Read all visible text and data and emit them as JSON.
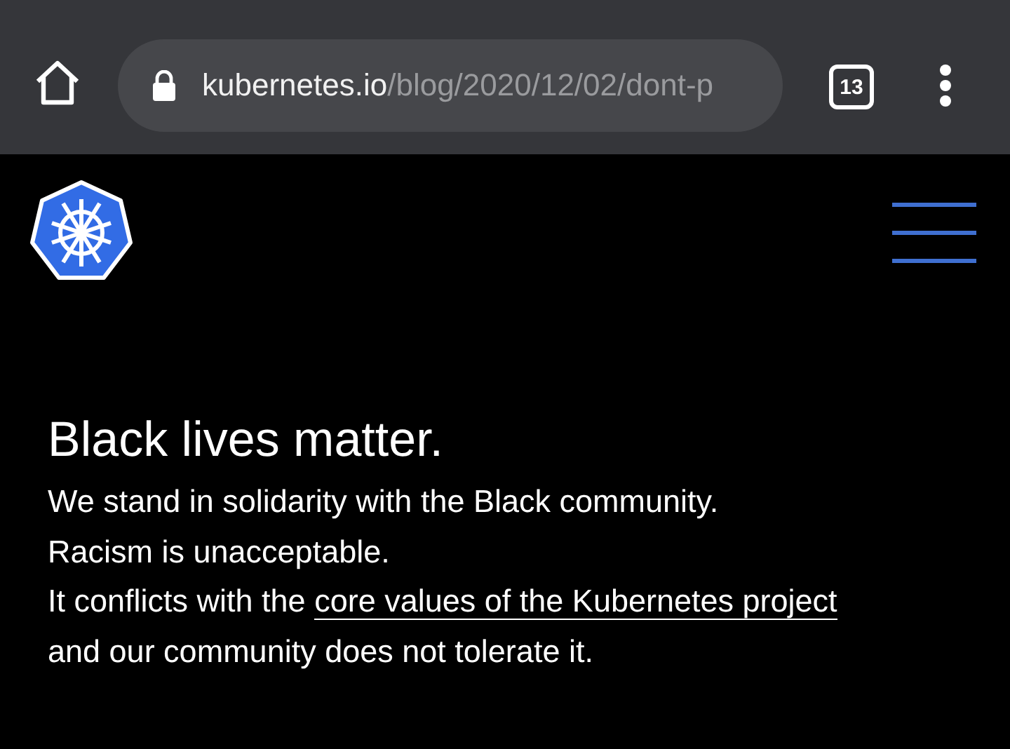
{
  "browser": {
    "url": {
      "host": "kubernetes.io",
      "path": "/blog/2020/12/02/dont-p"
    },
    "tab_count": "13"
  },
  "banner": {
    "heading": "Black lives matter.",
    "statement": [
      {
        "kind": "text",
        "text": "We stand in solidarity with the Black community."
      },
      {
        "kind": "break"
      },
      {
        "kind": "text",
        "text": "Racism is unacceptable."
      },
      {
        "kind": "break"
      },
      {
        "kind": "text",
        "text": "It conflicts with the "
      },
      {
        "kind": "link",
        "text": "core values of the Kubernetes project"
      },
      {
        "kind": "break"
      },
      {
        "kind": "text",
        "text": "and our community does not tolerate it."
      }
    ]
  }
}
